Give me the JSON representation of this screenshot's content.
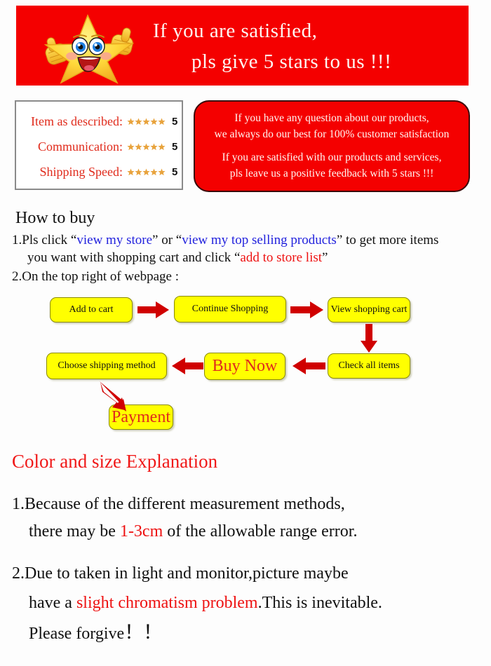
{
  "banner": {
    "line1": "If you are satisfied,",
    "line2": "pls give 5 stars to us !!!",
    "bg_color": "#f40000",
    "text_color": "#fdf6f2",
    "mascot_icon": "thumbs-up-star-mascot-icon"
  },
  "ratings": {
    "rows": [
      {
        "label": "Item as described:",
        "stars": 5,
        "score": "5"
      },
      {
        "label": "Communication:",
        "stars": 5,
        "score": "5"
      },
      {
        "label": "Shipping Speed:",
        "stars": 5,
        "score": "5"
      }
    ],
    "label_color": "#e02b1c",
    "star_color": "#e8a33d"
  },
  "message_box": {
    "line1": "If you have any question about our products,",
    "line2": "we always do our best for 100% customer satisfaction",
    "line3": "If you are satisfied with our products and services,",
    "line4": "pls leave us a positive feedback with 5 stars !!!",
    "bg_color": "#f40000",
    "text_color": "#fff6f2"
  },
  "how_to_buy": {
    "title": "How to buy",
    "item1": {
      "part1": "1.Pls click “",
      "link1": "view my store",
      "part2": "” or “",
      "link2": "view my top selling products",
      "part3": "” to get more items",
      "line2_part1": "you want with shopping cart and click “",
      "line2_red": "add to store list",
      "line2_part2": "”"
    },
    "item2": "2.On the top right of webpage :"
  },
  "flowchart": {
    "boxes": [
      {
        "id": "add-to-cart",
        "label": "Add to cart"
      },
      {
        "id": "continue-shopping",
        "label": "Continue Shopping"
      },
      {
        "id": "view-cart",
        "label": "View shopping cart"
      },
      {
        "id": "check-all",
        "label": "Check all items"
      },
      {
        "id": "buy-now",
        "label": "Buy Now"
      },
      {
        "id": "choose-shipping",
        "label": "Choose shipping method"
      },
      {
        "id": "payment",
        "label": "Payment"
      }
    ],
    "box_bg": "#ffff00",
    "arrow_color": "#d00000",
    "highlight_text_color": "#e02b1c"
  },
  "color_size": {
    "title": "Color and size Explanation",
    "item1_line1": "1.Because of the different measurement methods,",
    "item1_line2_pre": "there may be ",
    "item1_line2_red": "1-3cm",
    "item1_line2_post": " of the allowable range error.",
    "item2_line1": "2.Due to taken in light and monitor,picture maybe",
    "item2_line2_pre": "have a ",
    "item2_line2_red": "slight chromatism problem",
    "item2_line2_post": ".This is inevitable.",
    "item2_line3": "Please forgive",
    "item2_line3_bang": "！！",
    "title_color": "#f01818",
    "accent_color": "#ee1111"
  }
}
